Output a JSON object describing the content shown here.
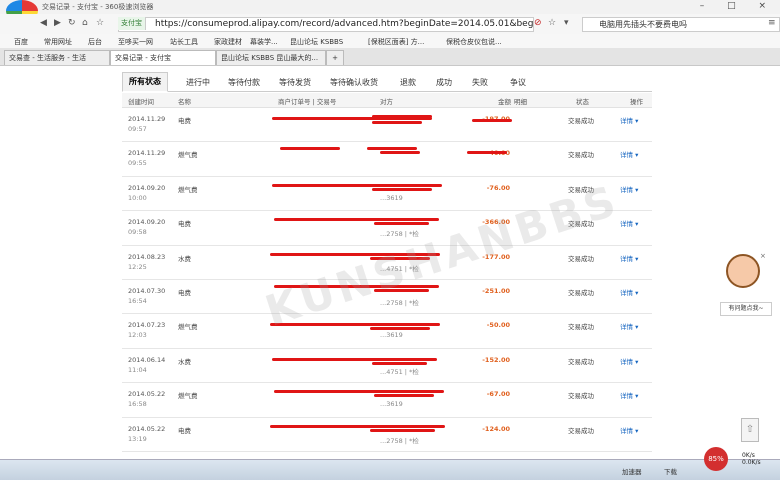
{
  "browser": {
    "window_title": "交易记录 - 支付宝 - 360极速浏览器",
    "window_controls": "– □ ×",
    "badge": "支付宝",
    "url": "https://consumeprod.alipay.com/record/advanced.htm?beginDate=2014.05.01&beginTime=0(",
    "search_text": "电脑用先插头不要费电吗",
    "favorites": [
      "百度",
      "常用网址",
      "后台",
      "至哆买一网",
      "站长工具",
      "家政建材",
      "幕装学...",
      "昆山论坛 KSBBS",
      "[保税区面表] 方...",
      "保税仓皮仪包说..."
    ],
    "tabs": [
      "交易查 - 生活服务 - 生活",
      "交易记录 - 支付宝",
      "昆山论坛 KSBBS 昆山最大的...",
      "+"
    ]
  },
  "filter_tabs": [
    "所有状态",
    "进行中",
    "等待付款",
    "等待发货",
    "等待确认收货",
    "退款",
    "成功",
    "失败",
    "争议"
  ],
  "table_headers": {
    "time": "创建时间",
    "name": "名称",
    "merchant_no": "商户订单号 | 交易号",
    "party": "对方",
    "amount": "金额",
    "detail_col": "明细",
    "status": "状态",
    "action": "操作"
  },
  "rows": [
    {
      "date": "2014.11.29",
      "time": "09:57",
      "name": "电费",
      "party_no": "",
      "amount": "-197.00",
      "status": "交易成功",
      "detail": "详情 ▾"
    },
    {
      "date": "2014.11.29",
      "time": "09:55",
      "name": "燃气费",
      "party_no": "",
      "amount": "-40.00",
      "status": "交易成功",
      "detail": "详情 ▾"
    },
    {
      "date": "2014.09.20",
      "time": "10:00",
      "name": "燃气费",
      "party_no": "...3619",
      "amount": "-76.00",
      "status": "交易成功",
      "detail": "详情 ▾"
    },
    {
      "date": "2014.09.20",
      "time": "09:58",
      "name": "电费",
      "party_no": "...2758 | *检",
      "amount": "-366.00",
      "status": "交易成功",
      "detail": "详情 ▾"
    },
    {
      "date": "2014.08.23",
      "time": "12:25",
      "name": "水费",
      "party_no": "...4751 | *检",
      "amount": "-177.00",
      "status": "交易成功",
      "detail": "详情 ▾"
    },
    {
      "date": "2014.07.30",
      "time": "16:54",
      "name": "电费",
      "party_no": "...2758 | *检",
      "amount": "-251.00",
      "status": "交易成功",
      "detail": "详情 ▾"
    },
    {
      "date": "2014.07.23",
      "time": "12:03",
      "name": "燃气费",
      "party_no": "...3619",
      "amount": "-50.00",
      "status": "交易成功",
      "detail": "详情 ▾"
    },
    {
      "date": "2014.06.14",
      "time": "11:04",
      "name": "水费",
      "party_no": "...4751 | *检",
      "amount": "-152.00",
      "status": "交易成功",
      "detail": "详情 ▾"
    },
    {
      "date": "2014.05.22",
      "time": "16:58",
      "name": "燃气费",
      "party_no": "...3619",
      "amount": "-67.00",
      "status": "交易成功",
      "detail": "详情 ▾"
    },
    {
      "date": "2014.05.22",
      "time": "13:19",
      "name": "电费",
      "party_no": "...2758 | *检",
      "amount": "-124.00",
      "status": "交易成功",
      "detail": "详情 ▾"
    }
  ],
  "watermark": "KUNSHANBBS",
  "side_widget": {
    "label": "有问题点我~",
    "close": "×"
  },
  "status_bar": {
    "left": "",
    "items": [
      "加速器",
      "下载"
    ],
    "speed": "85%",
    "net_up": "0K/s",
    "net_down": "0.0K/s"
  },
  "colors": {
    "amount": "#e0601e",
    "link": "#1565c0",
    "redaction": "#e01515"
  }
}
